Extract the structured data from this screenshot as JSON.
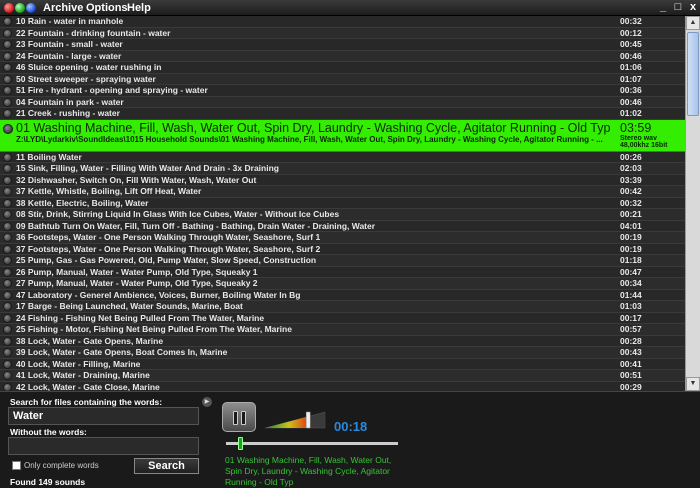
{
  "menu": {
    "items": [
      "Archive",
      "Options",
      "Help"
    ],
    "window_controls": [
      "_",
      "□",
      "x"
    ]
  },
  "list": {
    "rows": [
      {
        "name": "10 Rain - water in manhole",
        "duration": "00:32"
      },
      {
        "name": "22 Fountain - drinking fountain - water",
        "duration": "00:12"
      },
      {
        "name": "23 Fountain - small - water",
        "duration": "00:45"
      },
      {
        "name": "24 Fountain - large - water",
        "duration": "00:46"
      },
      {
        "name": "46 Sluice opening - water rushing in",
        "duration": "01:06"
      },
      {
        "name": "50 Street sweeper - spraying water",
        "duration": "01:07"
      },
      {
        "name": "51 Fire - hydrant - opening and spraying - water",
        "duration": "00:36"
      },
      {
        "name": "04 Fountain in park - water",
        "duration": "00:46"
      },
      {
        "name": "21 Creek - rushing - water",
        "duration": "01:02"
      }
    ],
    "selected": {
      "name": "01 Washing Machine, Fill, Wash, Water Out, Spin Dry, Laundry - Washing Cycle, Agitator Running - Old Typ",
      "duration": "03:59",
      "path": "Z:\\LYD\\Lydarkiv\\SoundIdeas\\1015 Household Sounds\\01 Washing Machine, Fill, Wash, Water Out, Spin Dry, Laundry - Washing Cycle, Agitator Running - ...",
      "meta": "Stereo    wav 48,00khz 16bit"
    },
    "rows_after": [
      {
        "name": "11 Boiling Water",
        "duration": "00:26"
      },
      {
        "name": "15 Sink, Filling, Water - Filling With Water And Drain - 3x Draining",
        "duration": "02:03"
      },
      {
        "name": "32 Dishwasher, Switch On, Fill With Water, Wash, Water Out",
        "duration": "03:39"
      },
      {
        "name": "37 Kettle, Whistle, Boiling, Lift Off Heat, Water",
        "duration": "00:42"
      },
      {
        "name": "38 Kettle, Electric, Boiling, Water",
        "duration": "00:32"
      },
      {
        "name": "08 Stir, Drink, Stirring Liquid In Glass With Ice Cubes, Water - Without Ice Cubes",
        "duration": "00:21"
      },
      {
        "name": "09 Bathtub Turn On Water, Fill, Turn Off -  Bathing - Bathing, Drain Water - Draining, Water",
        "duration": "04:01"
      },
      {
        "name": "36 Footsteps, Water - One Person Walking Through Water, Seashore, Surf 1",
        "duration": "00:19"
      },
      {
        "name": "37 Footsteps, Water - One Person Walking Through Water, Seashore, Surf 2",
        "duration": "00:19"
      },
      {
        "name": "25 Pump, Gas - Gas Powered, Old, Pump Water, Slow Speed, Construction",
        "duration": "01:18"
      },
      {
        "name": "26 Pump, Manual, Water - Water Pump, Old Type, Squeaky 1",
        "duration": "00:47"
      },
      {
        "name": "27 Pump, Manual, Water - Water Pump, Old Type, Squeaky 2",
        "duration": "00:34"
      },
      {
        "name": "47 Laboratory - Generel Ambience, Voices, Burner, Boiling Water In Bg",
        "duration": "01:44"
      },
      {
        "name": "17 Barge - Being Launched, Water Sounds, Marine, Boat",
        "duration": "01:03"
      },
      {
        "name": "24 Fishing - Fishing Net Being Pulled From The Water, Marine",
        "duration": "00:17"
      },
      {
        "name": "25 Fishing - Motor, Fishing Net Being Pulled From The Water, Marine",
        "duration": "00:57"
      },
      {
        "name": "38 Lock, Water - Gate Opens, Marine",
        "duration": "00:28"
      },
      {
        "name": "39 Lock, Water - Gate Opens,  Boat Comes In, Marine",
        "duration": "00:43"
      },
      {
        "name": "40 Lock, Water - Filling, Marine",
        "duration": "00:41"
      },
      {
        "name": "41 Lock, Water - Draining, Marine",
        "duration": "00:51"
      },
      {
        "name": "42 Lock, Water - Gate Close, Marine",
        "duration": "00:29"
      }
    ]
  },
  "search": {
    "label": "Search for files containing the words:",
    "value": "Water",
    "without_label": "Without the words:",
    "without_value": "",
    "only_complete_words_label": "Only complete words",
    "only_complete_words_checked": false,
    "button_label": "Search",
    "found_text": "Found 149 sounds"
  },
  "player": {
    "time": "00:18",
    "progress_fraction": 0.08,
    "volume_fraction": 0.72,
    "now_playing": "01 Washing Machine, Fill, Wash, Water Out, Spin Dry, Laundry - Washing Cycle, Agitator Running - Old Typ",
    "pause_icon": "pause-icon"
  },
  "colors": {
    "selected_row": "#33ee00",
    "time_text": "#2a8adc",
    "now_playing_text": "#37c437"
  }
}
